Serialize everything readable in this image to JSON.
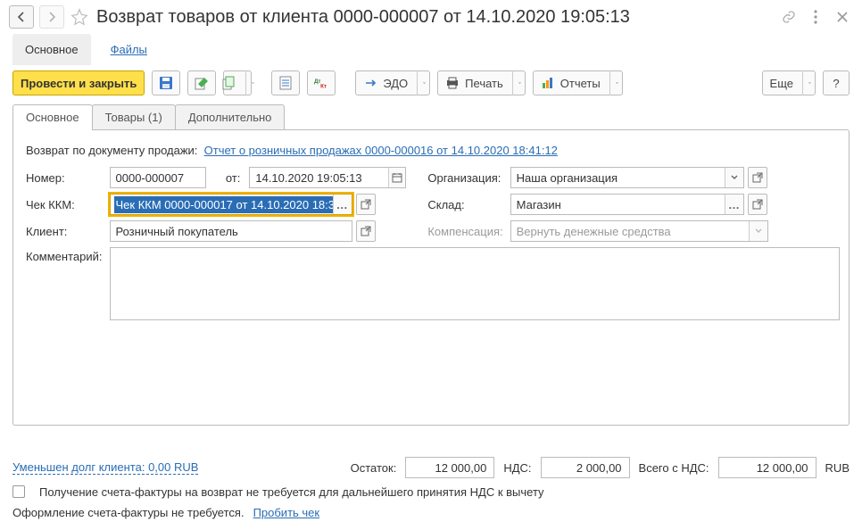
{
  "title": "Возврат товаров от клиента 0000-000007 от 14.10.2020 19:05:13",
  "nav": {
    "main": "Основное",
    "files": "Файлы"
  },
  "toolbar": {
    "post_close": "Провести и закрыть",
    "edo": "ЭДО",
    "print": "Печать",
    "reports": "Отчеты",
    "more": "Еще",
    "help": "?"
  },
  "tabs": {
    "main": "Основное",
    "goods": "Товары (1)",
    "extra": "Дополнительно"
  },
  "form": {
    "by_doc_label": "Возврат по документу продажи:",
    "by_doc_link": "Отчет о розничных продажах 0000-000016 от 14.10.2020 18:41:12",
    "number_label": "Номер:",
    "number": "0000-000007",
    "ot_label": "от:",
    "date": "14.10.2020 19:05:13",
    "org_label": "Организация:",
    "org": "Наша организация",
    "kkm_label": "Чек ККМ:",
    "kkm": "Чек ККМ 0000-000017 от 14.10.2020 18:3",
    "warehouse_label": "Склад:",
    "warehouse": "Магазин",
    "client_label": "Клиент:",
    "client": "Розничный покупатель",
    "comp_label": "Компенсация:",
    "comp": "Вернуть денежные средства",
    "comment_label": "Комментарий:",
    "comment": ""
  },
  "footer": {
    "debt_link": "Уменьшен долг клиента: 0,00 RUB",
    "ostatok_label": "Остаток:",
    "ostatok": "12 000,00",
    "nds_label": "НДС:",
    "nds": "2 000,00",
    "total_label": "Всего с НДС:",
    "total": "12 000,00",
    "currency": "RUB",
    "chk_label": "Получение счета-фактуры на возврат не требуется для дальнейшего принятия НДС к вычету",
    "sf_text": "Оформление счета-фактуры не требуется.",
    "probit": "Пробить чек"
  }
}
